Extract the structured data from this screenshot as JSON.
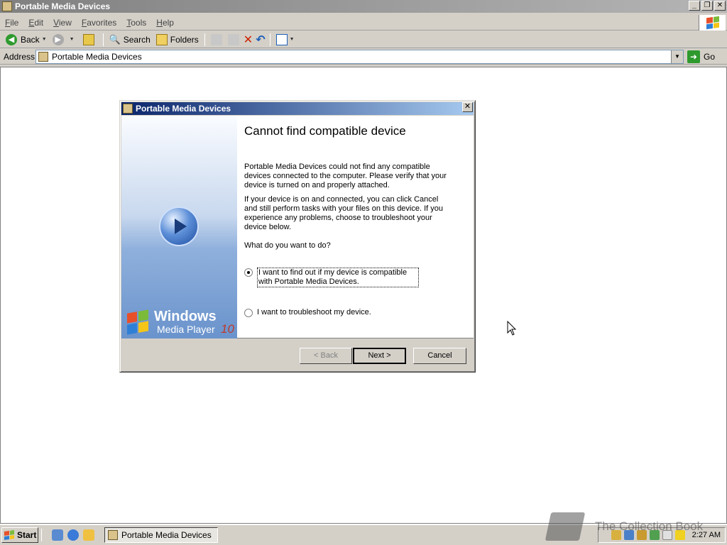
{
  "window": {
    "title": "Portable Media Devices",
    "buttons": {
      "minimize": "_",
      "maximize": "❐",
      "close": "✕"
    }
  },
  "menu": {
    "items": [
      {
        "label": "File",
        "key": "F",
        "rest": "ile"
      },
      {
        "label": "Edit",
        "key": "E",
        "rest": "dit"
      },
      {
        "label": "View",
        "key": "V",
        "rest": "iew"
      },
      {
        "label": "Favorites",
        "key": "F",
        "rest": "avorites"
      },
      {
        "label": "Tools",
        "key": "T",
        "rest": "ools"
      },
      {
        "label": "Help",
        "key": "H",
        "rest": "elp"
      }
    ]
  },
  "toolbar": {
    "back_label": "Back",
    "search_label": "Search",
    "folders_label": "Folders"
  },
  "address": {
    "label": "Address",
    "value": "Portable Media Devices",
    "go_label": "Go"
  },
  "dialog": {
    "title": "Portable Media Devices",
    "heading": "Cannot find compatible device",
    "paragraph1": "Portable Media Devices could not find any compatible devices connected to the computer. Please verify that your device is turned on and properly attached.",
    "paragraph2": "If your device is on and connected, you can click Cancel and still perform tasks with your files on this device. If you experience any problems, choose to troubleshoot your device below.",
    "question": "What do you want to do?",
    "option1": "I want to find out if my device is compatible with Portable Media Devices.",
    "option2": "I want to troubleshoot my device.",
    "selected_option": 1,
    "brand_line1": "Windows",
    "brand_line2": "Media Player",
    "brand_version": "10",
    "back_button": "< Back",
    "next_button": "Next >",
    "cancel_button": "Cancel"
  },
  "taskbar": {
    "start_label": "Start",
    "task_label": "Portable Media Devices",
    "clock": "2:27 AM"
  },
  "watermark": {
    "text": "The Collection Book"
  },
  "colors": {
    "dialog_title_start": "#0a246a",
    "dialog_title_end": "#a6caf0",
    "go_green": "#2e9a2e",
    "close_red": "#cc2200"
  }
}
